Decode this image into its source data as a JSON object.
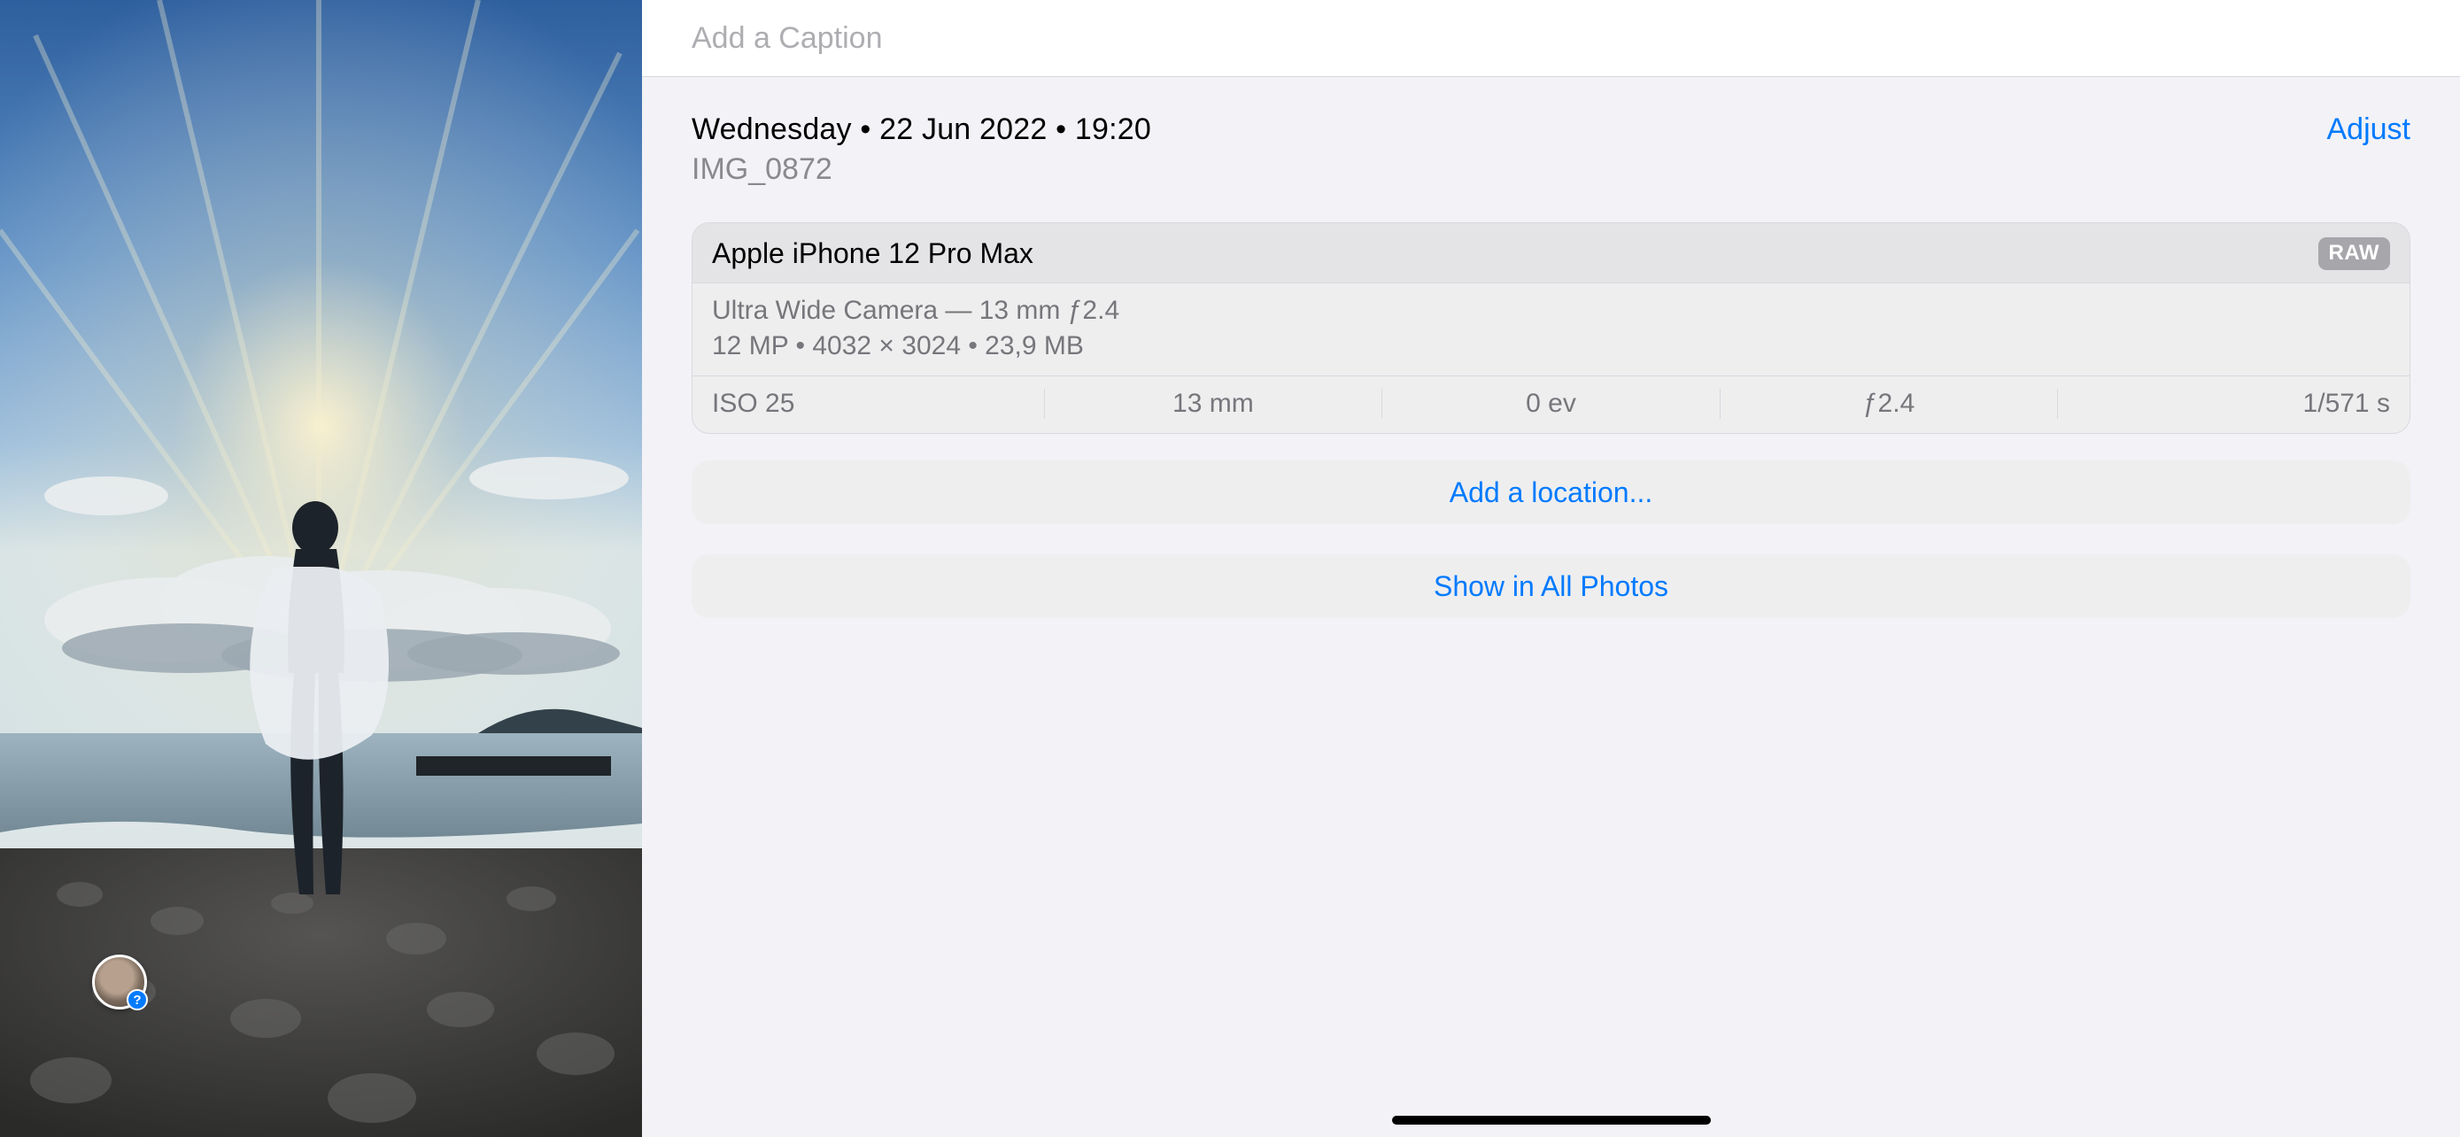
{
  "caption": {
    "placeholder": "Add a Caption"
  },
  "datetime": "Wednesday • 22 Jun 2022 • 19:20",
  "adjust_label": "Adjust",
  "filename": "IMG_0872",
  "device_model": "Apple iPhone 12 Pro Max",
  "format_badge": "RAW",
  "lens_line": "Ultra Wide Camera — 13 mm ƒ2.4",
  "dims_line": "12 MP  •  4032 × 3024  •  23,9 MB",
  "exif": {
    "iso": "ISO 25",
    "focal": "13 mm",
    "ev": "0 ev",
    "aperture": "ƒ2.4",
    "shutter": "1/571 s"
  },
  "add_location_label": "Add a location...",
  "show_all_label": "Show in All Photos",
  "face_badge_glyph": "?"
}
